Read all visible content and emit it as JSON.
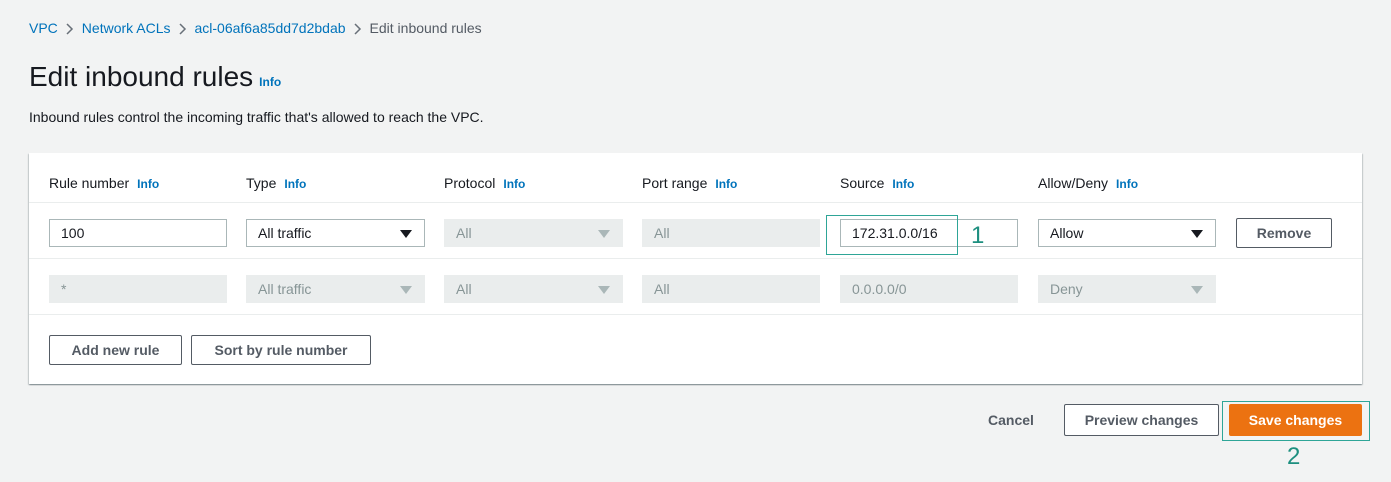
{
  "breadcrumb": {
    "items": [
      "VPC",
      "Network ACLs",
      "acl-06af6a85dd7d2bdab"
    ],
    "current": "Edit inbound rules"
  },
  "page": {
    "title": "Edit inbound rules",
    "title_info": "Info",
    "description": "Inbound rules control the incoming traffic that's allowed to reach the VPC."
  },
  "table": {
    "headers": [
      {
        "label": "Rule number",
        "info": "Info"
      },
      {
        "label": "Type",
        "info": "Info"
      },
      {
        "label": "Protocol",
        "info": "Info"
      },
      {
        "label": "Port range",
        "info": "Info"
      },
      {
        "label": "Source",
        "info": "Info"
      },
      {
        "label": "Allow/Deny",
        "info": "Info"
      }
    ],
    "rows": [
      {
        "rule_number": "100",
        "type": "All traffic",
        "protocol": "All",
        "port_range": "All",
        "source": "172.31.0.0/16",
        "allow_deny": "Allow",
        "remove_label": "Remove"
      },
      {
        "rule_number": "*",
        "type": "All traffic",
        "protocol": "All",
        "port_range": "All",
        "source": "0.0.0.0/0",
        "allow_deny": "Deny"
      }
    ],
    "add_rule_label": "Add new rule",
    "sort_label": "Sort by rule number"
  },
  "footer": {
    "cancel_label": "Cancel",
    "preview_label": "Preview changes",
    "save_label": "Save changes"
  },
  "annotations": {
    "first": "1",
    "second": "2",
    "color": "#2ea597"
  },
  "colors": {
    "link": "#0073bb",
    "primary": "#ec7211",
    "background": "#f2f3f3"
  }
}
